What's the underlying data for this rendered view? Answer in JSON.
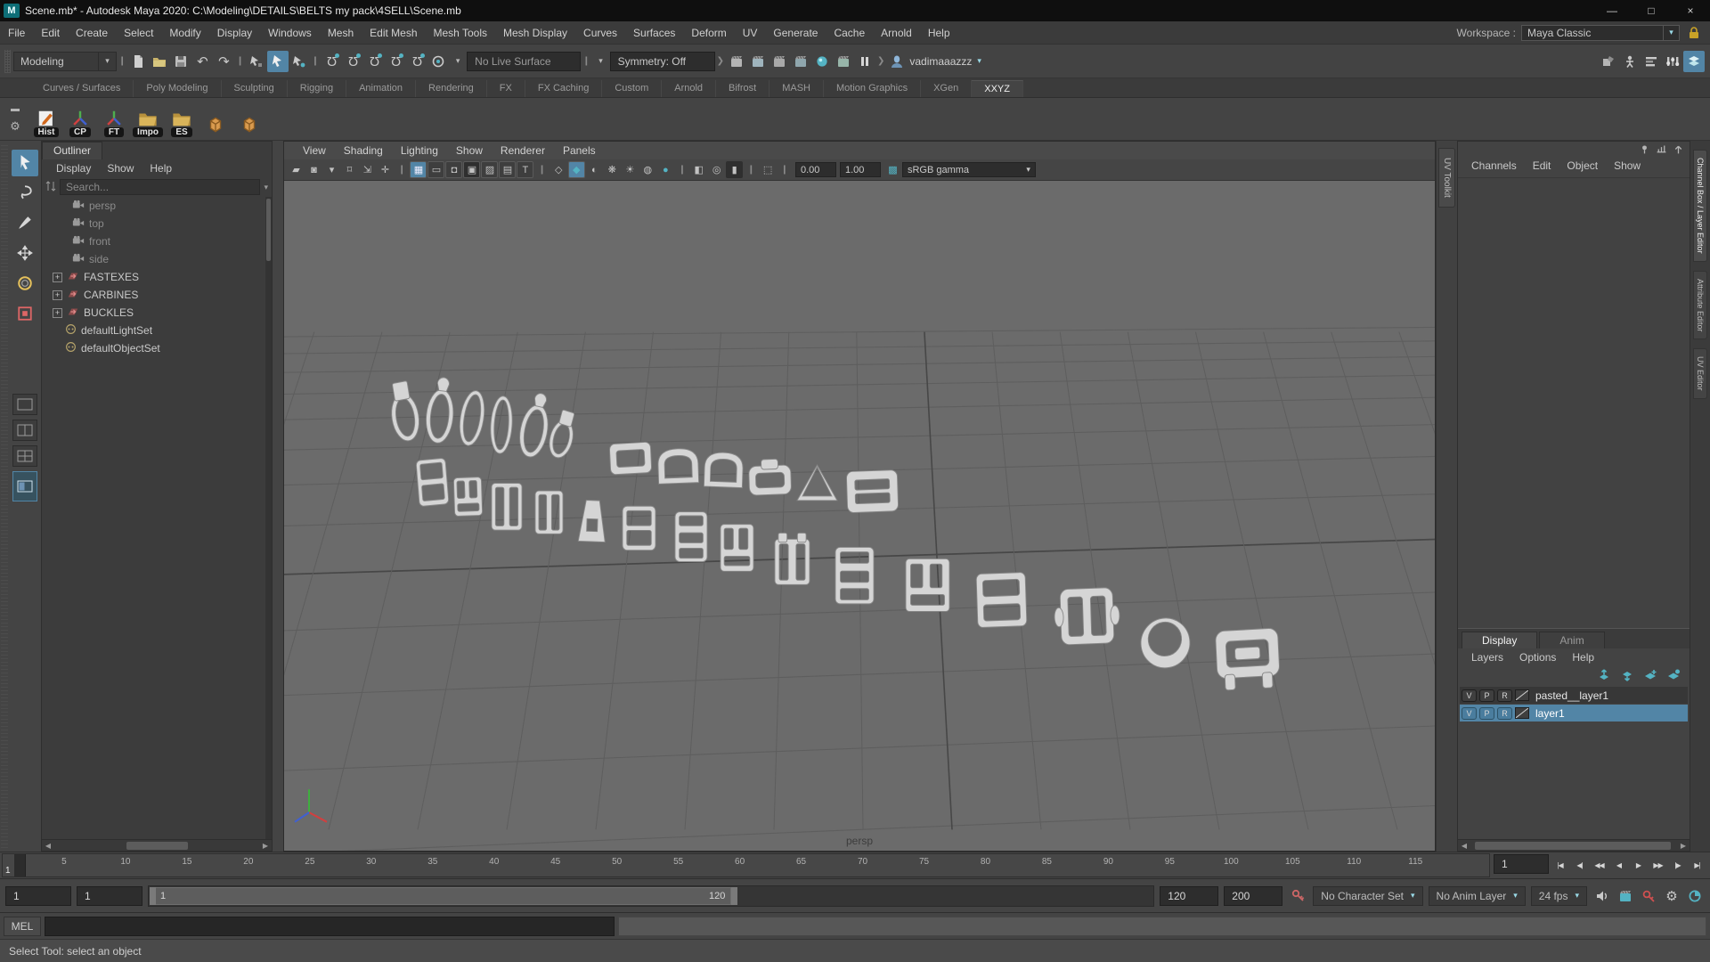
{
  "window": {
    "title": "Scene.mb* - Autodesk Maya 2020: C:\\Modeling\\DETAILS\\BELTS my pack\\4SELL\\Scene.mb",
    "logo": "M",
    "controls": [
      {
        "name": "minimize-button",
        "glyph": "—"
      },
      {
        "name": "maximize-button",
        "glyph": "□"
      },
      {
        "name": "close-button",
        "glyph": "×"
      }
    ]
  },
  "menubar": {
    "items": [
      "File",
      "Edit",
      "Create",
      "Select",
      "Modify",
      "Display",
      "Windows",
      "Mesh",
      "Edit Mesh",
      "Mesh Tools",
      "Mesh Display",
      "Curves",
      "Surfaces",
      "Deform",
      "UV",
      "Generate",
      "Cache",
      "Arnold",
      "Help"
    ],
    "workspace_label": "Workspace :",
    "workspace_value": "Maya Classic"
  },
  "statusline": {
    "menuset": "Modeling",
    "file_icons": [
      "new-scene-icon",
      "open-scene-icon",
      "save-scene-icon"
    ],
    "history_icons": [
      "undo-icon",
      "redo-icon"
    ],
    "selectmode_icons": [
      "select-hierarchy-icon",
      "select-object-icon",
      "select-component-icon"
    ],
    "snap_icons": [
      "snap-grid-icon",
      "snap-curve-icon",
      "snap-point-icon",
      "snap-projected-center-icon",
      "snap-view-plane-icon",
      "make-live-icon"
    ],
    "no_live_surface": "No Live Surface",
    "symmetry": "Symmetry: Off",
    "render_icons": [
      "open-render-view-icon",
      "ipr-render-icon",
      "render-current-frame-icon",
      "render-settings-icon",
      "light-editor-icon",
      "render-sequence-icon",
      "pause-viewport-icon"
    ],
    "user": "vadimaaazzz",
    "sidebar_icons": [
      "modeling-toolkit-icon",
      "humanik-icon",
      "attribute-editor-icon",
      "tool-settings-icon",
      "channel-box-icon"
    ]
  },
  "shelf": {
    "tabs": [
      "Curves / Surfaces",
      "Poly Modeling",
      "Sculpting",
      "Rigging",
      "Animation",
      "Rendering",
      "FX",
      "FX Caching",
      "Custom",
      "Arnold",
      "Bifrost",
      "MASH",
      "Motion Graphics",
      "XGen",
      "XXYZ"
    ],
    "active_tab": "XXYZ",
    "buttons": [
      {
        "label": "Hist",
        "icon": "pencil-doc-icon"
      },
      {
        "label": "CP",
        "icon": "axis-tripod-icon"
      },
      {
        "label": "FT",
        "icon": "axis-tripod-icon"
      },
      {
        "label": "Impo",
        "icon": "folder-icon"
      },
      {
        "label": "ES",
        "icon": "folder-icon"
      }
    ],
    "extra_icons": [
      "poly-cube-icon",
      "poly-cube-icon"
    ]
  },
  "toolbox": {
    "tools": [
      {
        "name": "select-tool",
        "icon": "arrow-cursor-icon",
        "active": true
      },
      {
        "name": "lasso-tool",
        "icon": "lasso-icon",
        "active": false
      },
      {
        "name": "paint-select-tool",
        "icon": "brush-icon",
        "active": false
      },
      {
        "name": "move-tool",
        "icon": "move-icon",
        "active": false
      },
      {
        "name": "rotate-tool",
        "icon": "rotate-icon",
        "active": false
      },
      {
        "name": "scale-tool",
        "icon": "scale-icon",
        "active": false
      }
    ]
  },
  "outliner": {
    "title": "Outliner",
    "menu": [
      "Display",
      "Show",
      "Help"
    ],
    "search_placeholder": "Search...",
    "cameras": [
      "persp",
      "top",
      "front",
      "side"
    ],
    "groups": [
      "FASTEXES",
      "CARBINES",
      "BUCKLES"
    ],
    "sets": [
      "defaultLightSet",
      "defaultObjectSet"
    ]
  },
  "viewport": {
    "menu": [
      "View",
      "Shading",
      "Lighting",
      "Show",
      "Renderer",
      "Panels"
    ],
    "exposure": "0.00",
    "gamma": "1.00",
    "view_transform": "sRGB gamma",
    "camera_label": "persp",
    "uv_toolkit_label": "UV Toolkit"
  },
  "channelbox": {
    "menu": [
      "Channels",
      "Edit",
      "Object",
      "Show"
    ],
    "header_icons": [
      "pin-channel-icon",
      "speed-slider-icon",
      "manipulator-icon"
    ],
    "side_tabs": [
      "Channel Box / Layer Editor",
      "Attribute Editor",
      "UV Editor"
    ]
  },
  "layers": {
    "tabs": [
      "Display",
      "Anim"
    ],
    "active_tab": "Display",
    "menu": [
      "Layers",
      "Options",
      "Help"
    ],
    "op_icons": [
      "move-layer-up-icon",
      "move-layer-down-icon",
      "new-empty-layer-icon",
      "new-layer-selected-icon"
    ],
    "toggles": [
      "V",
      "P",
      "R"
    ],
    "rows": [
      {
        "name": "pasted__layer1",
        "selected": false
      },
      {
        "name": "layer1",
        "selected": true
      }
    ]
  },
  "timeline": {
    "ticks": [
      5,
      10,
      15,
      20,
      25,
      30,
      35,
      40,
      45,
      50,
      55,
      60,
      65,
      70,
      75,
      80,
      85,
      90,
      95,
      100,
      105,
      110,
      115
    ],
    "current_frame": "1",
    "frame_field": "1",
    "playback": [
      {
        "name": "go-to-start-button",
        "glyph": "|◀"
      },
      {
        "name": "step-back-frame-button",
        "glyph": "◀|"
      },
      {
        "name": "step-back-key-button",
        "glyph": "◀◀"
      },
      {
        "name": "play-backwards-button",
        "glyph": "◀"
      },
      {
        "name": "play-forwards-button",
        "glyph": "▶"
      },
      {
        "name": "step-forward-key-button",
        "glyph": "▶▶"
      },
      {
        "name": "step-forward-frame-button",
        "glyph": "|▶"
      },
      {
        "name": "go-to-end-button",
        "glyph": "▶|"
      }
    ]
  },
  "rangebar": {
    "anim_start": "1",
    "play_start": "1",
    "bar_start": "1",
    "bar_end": "120",
    "play_end": "120",
    "anim_end": "200",
    "key_icon": "character-key-icon",
    "character_set": "No Character Set",
    "anim_layer": "No Anim Layer",
    "fps": "24 fps",
    "right_icons": [
      "speaker-icon",
      "clapperboard-icon",
      "autokey-icon",
      "preferences-gear-icon",
      "profiler-icon"
    ]
  },
  "commandline": {
    "label": "MEL"
  },
  "helpline": {
    "text": "Select Tool: select an object"
  },
  "colors": {
    "accent_blue": "#5285a6",
    "teal": "#54b3c3",
    "viewport_bg": "#6b6b6b",
    "layer_selected": "#5285a6"
  }
}
